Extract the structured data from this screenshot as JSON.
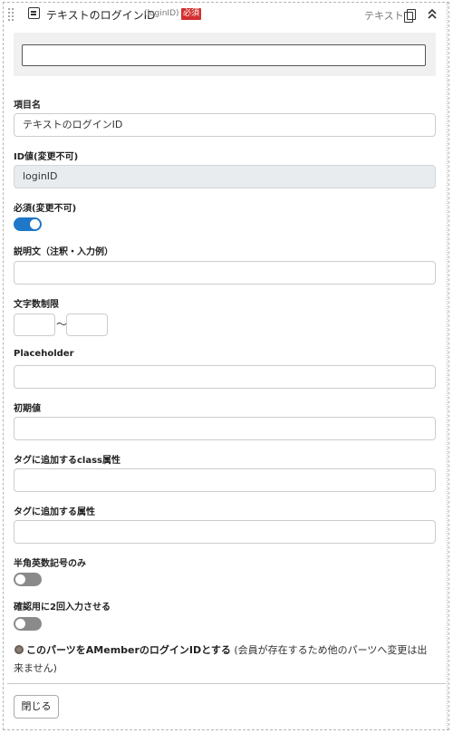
{
  "header": {
    "title": "テキストのログインID",
    "sub": "(loginID)",
    "required_badge": "必須",
    "field_type": "テキスト",
    "icons": {
      "drag": "drag-handle-icon",
      "type": "text-field-icon",
      "copy": "copy-icon",
      "collapse": "chevron-up-icon"
    }
  },
  "preview": {
    "value": ""
  },
  "fields": {
    "item_name": {
      "label": "項目名",
      "value": "テキストのログインID"
    },
    "id_value": {
      "label": "ID値(変更不可)",
      "value": "loginID"
    },
    "required": {
      "label": "必須(変更不可)",
      "state": "on"
    },
    "description": {
      "label": "説明文（注釈・入力例）",
      "value": ""
    },
    "char_limit": {
      "label": "文字数制限",
      "separator": "〜",
      "min": "",
      "max": ""
    },
    "placeholder": {
      "label": "Placeholder",
      "value": ""
    },
    "initial_value": {
      "label": "初期値",
      "value": ""
    },
    "class_attr": {
      "label": "タグに追加するclass属性",
      "value": ""
    },
    "tag_attr": {
      "label": "タグに追加する属性",
      "value": ""
    },
    "halfwidth_only": {
      "label": "半角英数記号のみ",
      "state": "off"
    },
    "confirm_twice": {
      "label": "確認用に2回入力させる",
      "state": "off"
    }
  },
  "member_login": {
    "label_bold": "このパーツをAMemberのログインIDとする",
    "note": " (会員が存在するため他のパーツへ変更は出来ません)"
  },
  "footer": {
    "close_label": "閉じる"
  },
  "colors": {
    "toggle_on": "#1e77c8",
    "toggle_off": "#8a8a8a",
    "badge": "#d32f2f"
  }
}
